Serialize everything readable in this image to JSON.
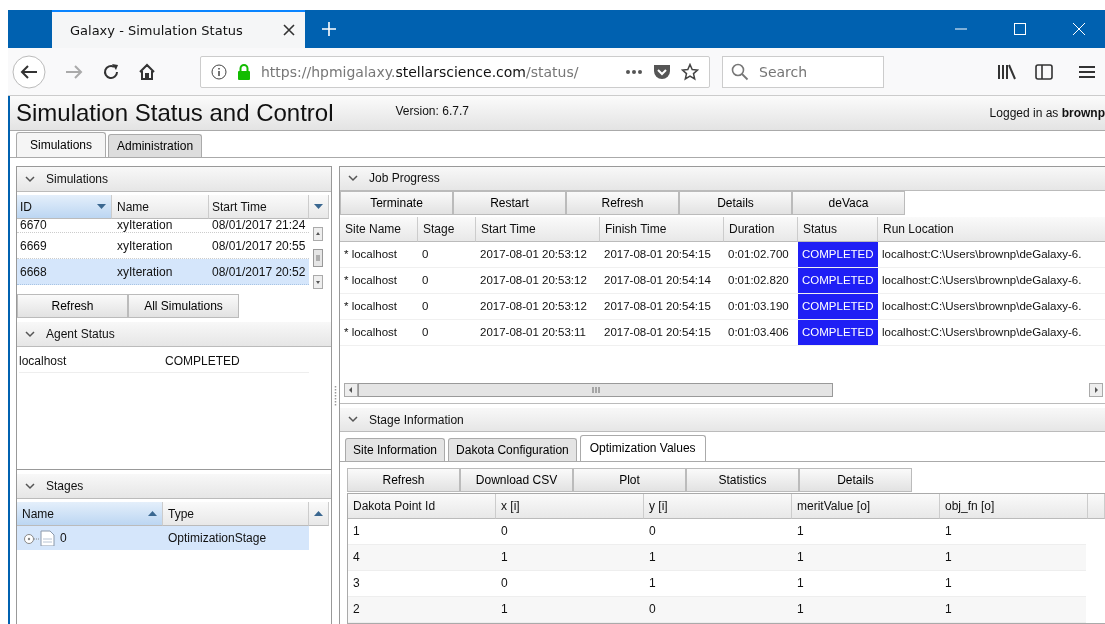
{
  "browser": {
    "tab_title": "Galaxy - Simulation Status",
    "url": {
      "prefix": "https://hpmigalaxy.",
      "domain": "stellarscience.com",
      "path": "/status/"
    },
    "search": {
      "placeholder": "Search"
    }
  },
  "app": {
    "title": "Simulation Status and Control",
    "version": "Version: 6.7.7",
    "user": "Logged in as **brownp**",
    "tabs": [
      {
        "label": "Simulations",
        "selected": true
      },
      {
        "label": "Administration",
        "selected": false
      }
    ]
  },
  "simulations": {
    "title": "Simulations",
    "columns": [
      {
        "label": "ID",
        "sorted_ascending": false,
        "sorted_descending": true
      },
      {
        "label": "Name",
        "sorted_ascending": false,
        "sorted_descending": false
      },
      {
        "label": "Start Time",
        "sorted_ascending": false,
        "sorted_descending": false
      }
    ],
    "rows": [
      {
        "cells": [
          "6670",
          "xyIteration",
          "08/01/2017 21:24"
        ],
        "selected": false
      },
      {
        "cells": [
          "6669",
          "xyIteration",
          "08/01/2017 20:55"
        ],
        "selected": false
      },
      {
        "cells": [
          "6668",
          "xyIteration",
          "08/01/2017 20:52"
        ],
        "selected": true
      }
    ],
    "buttons": [
      "Refresh",
      "All Simulations"
    ]
  },
  "agent_status": {
    "title": "Agent Status",
    "rows": [
      {
        "name": "localhost",
        "status": "COMPLETED"
      }
    ]
  },
  "stages": {
    "title": "Stages",
    "columns": [
      {
        "label": "Name",
        "sorted_ascending": true,
        "sorted_descending": false
      },
      {
        "label": "Type",
        "sorted_ascending": false,
        "sorted_descending": false
      }
    ],
    "rows": [
      {
        "name": "0",
        "type": "OptimizationStage",
        "selected": true
      }
    ]
  },
  "job_progress": {
    "title": "Job Progress",
    "buttons": [
      "Terminate",
      "Restart",
      "Refresh",
      "Details",
      "deVaca"
    ],
    "columns": [
      {
        "label": "Site Name",
        "kind": "text"
      },
      {
        "label": "Stage",
        "kind": "text"
      },
      {
        "label": "Start Time",
        "kind": "text"
      },
      {
        "label": "Finish Time",
        "kind": "text"
      },
      {
        "label": "Duration",
        "kind": "text"
      },
      {
        "label": "Status",
        "kind": "status"
      },
      {
        "label": "Run Location",
        "kind": "text"
      }
    ],
    "rows": [
      [
        "* localhost",
        "0",
        "2017-08-01 20:53:12",
        "2017-08-01 20:54:15",
        "0:01:02.700",
        "COMPLETED",
        "localhost:C:\\Users\\brownp\\deGalaxy-6."
      ],
      [
        "* localhost",
        "0",
        "2017-08-01 20:53:12",
        "2017-08-01 20:54:14",
        "0:01:02.820",
        "COMPLETED",
        "localhost:C:\\Users\\brownp\\deGalaxy-6."
      ],
      [
        "* localhost",
        "0",
        "2017-08-01 20:53:12",
        "2017-08-01 20:54:15",
        "0:01:03.190",
        "COMPLETED",
        "localhost:C:\\Users\\brownp\\deGalaxy-6."
      ],
      [
        "* localhost",
        "0",
        "2017-08-01 20:53:11",
        "2017-08-01 20:54:15",
        "0:01:03.406",
        "COMPLETED",
        "localhost:C:\\Users\\brownp\\deGalaxy-6."
      ]
    ]
  },
  "stage_information": {
    "title": "Stage Information",
    "tabs": [
      {
        "label": "Site Information",
        "selected": false
      },
      {
        "label": "Dakota Configuration",
        "selected": false
      },
      {
        "label": "Optimization Values",
        "selected": true
      }
    ],
    "buttons": [
      "Refresh",
      "Download CSV",
      "Plot",
      "Statistics",
      "Details"
    ],
    "columns": [
      "Dakota Point Id",
      "x [i]",
      "y [i]",
      "meritValue [o]",
      "obj_fn [o]"
    ],
    "rows": [
      [
        "1",
        "0",
        "0",
        "1",
        "1"
      ],
      [
        "4",
        "1",
        "1",
        "1",
        "1"
      ],
      [
        "3",
        "0",
        "1",
        "1",
        "1"
      ],
      [
        "2",
        "1",
        "0",
        "1",
        "1"
      ]
    ]
  }
}
